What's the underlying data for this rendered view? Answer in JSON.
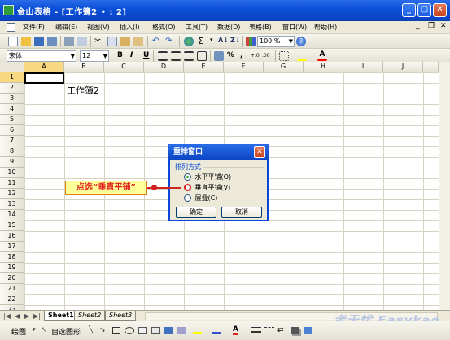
{
  "window": {
    "title": "金山表格 - [工作簿2 • : 2]"
  },
  "menubar": {
    "items": [
      "文件(F)",
      "编辑(E)",
      "视图(V)",
      "插入(I)",
      "格式(O)",
      "工具(T)",
      "数据(D)",
      "表格(B)",
      "窗口(W)",
      "帮助(H)"
    ]
  },
  "toolbar": {
    "zoom": "100 %",
    "font_name": "宋体",
    "font_size": "12",
    "bold": "B",
    "italic": "I",
    "underline": "U",
    "percent": "%",
    "comma": ","
  },
  "sheet": {
    "columns": [
      "A",
      "B",
      "C",
      "D",
      "E",
      "F",
      "G",
      "H",
      "I",
      "J"
    ],
    "rows": [
      "1",
      "2",
      "3",
      "4",
      "5",
      "6",
      "7",
      "8",
      "9",
      "10",
      "11",
      "12",
      "13",
      "14",
      "15",
      "16",
      "17",
      "18",
      "19",
      "20",
      "21",
      "22",
      "23"
    ],
    "cell_b2": "工作簿2",
    "tabs": [
      "Sheet1",
      "Sheet2",
      "Sheet3"
    ]
  },
  "dialog": {
    "title": "重排窗口",
    "group_label": "排列方式",
    "options": [
      "水平平铺(O)",
      "垂直平铺(V)",
      "层叠(C)"
    ],
    "ok": "确定",
    "cancel": "取消"
  },
  "annotation": {
    "text": "点选“垂直平铺”"
  },
  "drawbar": {
    "draw": "绘图",
    "autoshapes": "自选图形"
  },
  "watermark": "考无忧 Easykao",
  "colors": {
    "titlebar": "#0b50d8",
    "accent_red": "#d02020",
    "callout_bg": "#ffff99"
  }
}
